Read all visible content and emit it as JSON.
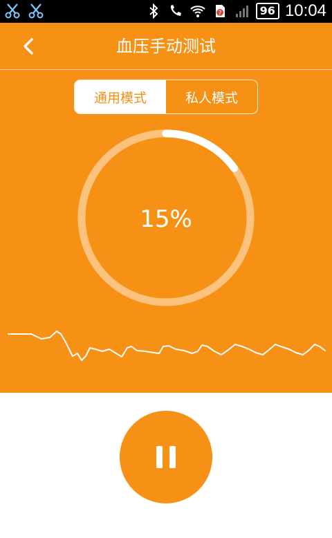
{
  "status_bar": {
    "left_icons": [
      "scissors-icon",
      "scissors-icon"
    ],
    "right_icons": [
      "bluetooth-icon",
      "phone-icon",
      "wifi-icon",
      "sim-alert-icon",
      "signal-icon"
    ],
    "battery": "96",
    "time": "10:04"
  },
  "header": {
    "back_icon": "chevron-left-icon",
    "title": "血压手动测试"
  },
  "mode_toggle": {
    "options": [
      "通用模式",
      "私人模式"
    ],
    "selected": "通用模式"
  },
  "progress": {
    "value": 0.15,
    "label": "15%"
  },
  "waveform": {
    "icon": "pulse-waveform"
  },
  "controls": {
    "pause_icon": "pause-icon"
  },
  "colors": {
    "accent": "#f79116",
    "text_on_accent": "#ffffff",
    "background": "#ffffff"
  }
}
